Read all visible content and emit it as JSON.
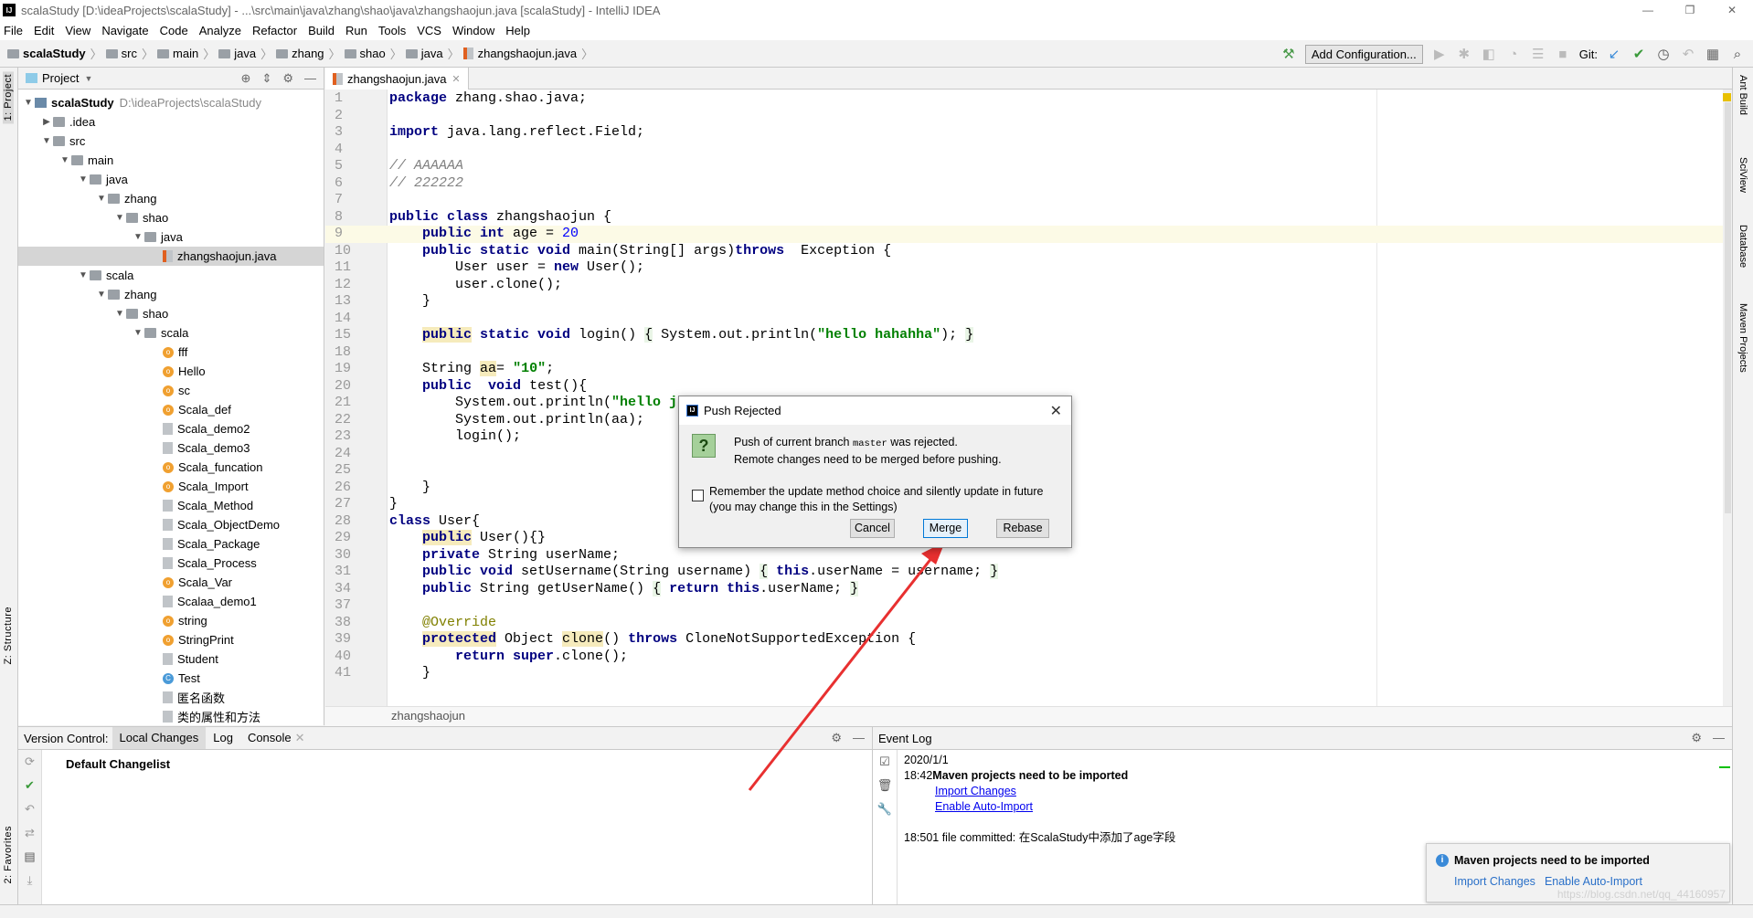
{
  "window": {
    "title": "scalaStudy [D:\\ideaProjects\\scalaStudy] - ...\\src\\main\\java\\zhang\\shao\\java\\zhangshaojun.java [scalaStudy] - IntelliJ IDEA",
    "logo": "IJ",
    "controls": [
      "—",
      "❐",
      "✕"
    ]
  },
  "menu": [
    "File",
    "Edit",
    "View",
    "Navigate",
    "Code",
    "Analyze",
    "Refactor",
    "Build",
    "Run",
    "Tools",
    "VCS",
    "Window",
    "Help"
  ],
  "breadcrumb": [
    "scalaStudy",
    "src",
    "main",
    "java",
    "zhang",
    "shao",
    "java",
    "zhangshaojun.java"
  ],
  "toolbar": {
    "add_configuration": "Add Configuration...",
    "git_label": "Git:"
  },
  "left_strip": {
    "project": "1: Project",
    "structure": "Z: Structure",
    "favorites": "2: Favorites"
  },
  "right_strip": [
    "Ant Build",
    "SciView",
    "Database",
    "Maven Projects"
  ],
  "project_panel": {
    "title": "Project",
    "tree": [
      {
        "label": "scalaStudy",
        "path": "D:\\ideaProjects\\scalaStudy",
        "level": 0,
        "icon": "mod",
        "open": true,
        "bold": true
      },
      {
        "label": ".idea",
        "level": 1,
        "icon": "folder",
        "open": false
      },
      {
        "label": "src",
        "level": 1,
        "icon": "folder",
        "open": true
      },
      {
        "label": "main",
        "level": 2,
        "icon": "folder",
        "open": true
      },
      {
        "label": "java",
        "level": 3,
        "icon": "folder",
        "open": true
      },
      {
        "label": "zhang",
        "level": 4,
        "icon": "folder",
        "open": true
      },
      {
        "label": "shao",
        "level": 5,
        "icon": "folder",
        "open": true
      },
      {
        "label": "java",
        "level": 6,
        "icon": "folder",
        "open": true
      },
      {
        "label": "zhangshaojun.java",
        "level": 7,
        "icon": "jav",
        "selected": true
      },
      {
        "label": "scala",
        "level": 3,
        "icon": "folder",
        "open": true
      },
      {
        "label": "zhang",
        "level": 4,
        "icon": "folder",
        "open": true
      },
      {
        "label": "shao",
        "level": 5,
        "icon": "folder",
        "open": true
      },
      {
        "label": "scala",
        "level": 6,
        "icon": "folder",
        "open": true
      },
      {
        "label": "fff",
        "level": 7,
        "icon": "obj"
      },
      {
        "label": "Hello",
        "level": 7,
        "icon": "obj"
      },
      {
        "label": "sc",
        "level": 7,
        "icon": "obj"
      },
      {
        "label": "Scala_def",
        "level": 7,
        "icon": "obj"
      },
      {
        "label": "Scala_demo2",
        "level": 7,
        "icon": "cls"
      },
      {
        "label": "Scala_demo3",
        "level": 7,
        "icon": "cls"
      },
      {
        "label": "Scala_funcation",
        "level": 7,
        "icon": "obj"
      },
      {
        "label": "Scala_Import",
        "level": 7,
        "icon": "obj"
      },
      {
        "label": "Scala_Method",
        "level": 7,
        "icon": "cls"
      },
      {
        "label": "Scala_ObjectDemo",
        "level": 7,
        "icon": "cls"
      },
      {
        "label": "Scala_Package",
        "level": 7,
        "icon": "cls"
      },
      {
        "label": "Scala_Process",
        "level": 7,
        "icon": "cls"
      },
      {
        "label": "Scala_Var",
        "level": 7,
        "icon": "obj"
      },
      {
        "label": "Scalaa_demo1",
        "level": 7,
        "icon": "cls"
      },
      {
        "label": "string",
        "level": 7,
        "icon": "obj"
      },
      {
        "label": "StringPrint",
        "level": 7,
        "icon": "obj"
      },
      {
        "label": "Student",
        "level": 7,
        "icon": "cls"
      },
      {
        "label": "Test",
        "level": 7,
        "icon": "tst"
      },
      {
        "label": "匿名函数",
        "level": 7,
        "icon": "cls"
      },
      {
        "label": "类的属性和方法",
        "level": 7,
        "icon": "cls"
      }
    ]
  },
  "editor": {
    "tab": "zhangshaojun.java",
    "breadcrumb": "zhangshaojun",
    "current_line": "9",
    "lines": [
      {
        "n": "1",
        "t": [
          [
            "package",
            "k"
          ],
          [
            " zhang.shao.java;"
          ]
        ]
      },
      {
        "n": "2",
        "t": []
      },
      {
        "n": "3",
        "t": [
          [
            "import",
            "k"
          ],
          [
            " java.lang.reflect.Field;"
          ]
        ]
      },
      {
        "n": "4",
        "t": []
      },
      {
        "n": "5",
        "t": [
          [
            "// AAAAAA",
            "c"
          ]
        ]
      },
      {
        "n": "6",
        "t": [
          [
            "// 222222",
            "c"
          ]
        ]
      },
      {
        "n": "7",
        "t": []
      },
      {
        "n": "8",
        "t": [
          [
            "public class",
            "k"
          ],
          [
            " zhangshaojun {"
          ]
        ]
      },
      {
        "n": "9",
        "t": [
          [
            "    "
          ],
          [
            "public int",
            "k"
          ],
          [
            " age = "
          ],
          [
            "20",
            "n"
          ]
        ]
      },
      {
        "n": "10",
        "t": [
          [
            "    "
          ],
          [
            "public static void",
            "k"
          ],
          [
            " main(String[] args)"
          ],
          [
            "throws",
            "k"
          ],
          [
            "  Exception {"
          ]
        ]
      },
      {
        "n": "11",
        "t": [
          [
            "        User user = "
          ],
          [
            "new",
            "k"
          ],
          [
            " User();"
          ]
        ]
      },
      {
        "n": "12",
        "t": [
          [
            "        user.clone();"
          ]
        ]
      },
      {
        "n": "13",
        "t": [
          [
            "    }"
          ]
        ]
      },
      {
        "n": "14",
        "t": []
      },
      {
        "n": "15",
        "t": [
          [
            "    "
          ],
          [
            "public",
            "k h"
          ],
          [
            " "
          ],
          [
            "static void",
            "k"
          ],
          [
            " login() "
          ],
          [
            "{",
            "f"
          ],
          [
            " System.out.println("
          ],
          [
            "\"hello hahahha\"",
            "s"
          ],
          [
            "); "
          ],
          [
            "}",
            "f"
          ]
        ]
      },
      {
        "n": "18",
        "t": []
      },
      {
        "n": "19",
        "t": [
          [
            "    String "
          ],
          [
            "aa",
            "h"
          ],
          [
            "= "
          ],
          [
            "\"10\"",
            "s"
          ],
          [
            ";"
          ]
        ]
      },
      {
        "n": "20",
        "t": [
          [
            "    "
          ],
          [
            "public",
            "k"
          ],
          [
            "  "
          ],
          [
            "void",
            "k"
          ],
          [
            " test(){"
          ]
        ]
      },
      {
        "n": "21",
        "t": [
          [
            "        System.out.println("
          ],
          [
            "\"hello j",
            "s"
          ]
        ]
      },
      {
        "n": "22",
        "t": [
          [
            "        System.out.println(aa);"
          ]
        ]
      },
      {
        "n": "23",
        "t": [
          [
            "        login();"
          ]
        ]
      },
      {
        "n": "24",
        "t": []
      },
      {
        "n": "25",
        "t": []
      },
      {
        "n": "26",
        "t": [
          [
            "    }"
          ]
        ]
      },
      {
        "n": "27",
        "t": [
          [
            "}"
          ]
        ]
      },
      {
        "n": "28",
        "t": [
          [
            "class",
            "k"
          ],
          [
            " User{"
          ]
        ]
      },
      {
        "n": "29",
        "t": [
          [
            "    "
          ],
          [
            "public",
            "k h"
          ],
          [
            " User(){}"
          ]
        ]
      },
      {
        "n": "30",
        "t": [
          [
            "    "
          ],
          [
            "private",
            "k"
          ],
          [
            " String userName;"
          ]
        ]
      },
      {
        "n": "31",
        "t": [
          [
            "    "
          ],
          [
            "public void",
            "k"
          ],
          [
            " setUsername(String username) "
          ],
          [
            "{",
            "f"
          ],
          [
            " "
          ],
          [
            "this",
            "k"
          ],
          [
            ".userName = username; "
          ],
          [
            "}",
            "f"
          ]
        ]
      },
      {
        "n": "34",
        "t": [
          [
            "    "
          ],
          [
            "public",
            "k"
          ],
          [
            " String getUserName() "
          ],
          [
            "{",
            "f"
          ],
          [
            " "
          ],
          [
            "return this",
            "k"
          ],
          [
            ".userName; "
          ],
          [
            "}",
            "f"
          ]
        ]
      },
      {
        "n": "37",
        "t": []
      },
      {
        "n": "38",
        "t": [
          [
            "    "
          ],
          [
            "@Override",
            "a"
          ]
        ]
      },
      {
        "n": "39",
        "t": [
          [
            "    "
          ],
          [
            "protected",
            "k h"
          ],
          [
            " Object "
          ],
          [
            "clone",
            "h"
          ],
          [
            "() "
          ],
          [
            "throws",
            "k"
          ],
          [
            " CloneNotSupportedException {"
          ]
        ]
      },
      {
        "n": "40",
        "t": [
          [
            "        "
          ],
          [
            "return super",
            "k"
          ],
          [
            ".clone();"
          ]
        ]
      },
      {
        "n": "41",
        "t": [
          [
            "    }"
          ]
        ]
      }
    ]
  },
  "version_control": {
    "label": "Version Control:",
    "tabs": [
      "Local Changes",
      "Log",
      "Console"
    ],
    "active_tab": "Local Changes",
    "changelist": "Default Changelist"
  },
  "event_log": {
    "title": "Event Log",
    "date": "2020/1/1",
    "entries": [
      {
        "time": "18:42",
        "message": "Maven projects need to be imported",
        "links": [
          "Import Changes",
          "Enable Auto-Import"
        ]
      },
      {
        "time": "18:50",
        "message": "1 file committed: 在ScalaStudy中添加了age字段"
      }
    ]
  },
  "notification": {
    "title": "Maven projects need to be imported",
    "links": [
      "Import Changes",
      "Enable Auto-Import"
    ]
  },
  "dialog": {
    "title": "Push Rejected",
    "message_prefix": "Push of current branch ",
    "branch": "master",
    "message_suffix": " was rejected.",
    "message_line2": "Remote changes need to be merged before pushing.",
    "checkbox_line1": "Remember the update method choice and silently update in future",
    "checkbox_line2": "(you may change this in the Settings)",
    "checked": false,
    "buttons": [
      "Cancel",
      "Merge",
      "Rebase"
    ],
    "default_button": "Merge"
  },
  "watermark": "https://blog.csdn.net/qq_44160957",
  "colors": {
    "keyword": "#000080",
    "string": "#008000",
    "number": "#0000ff",
    "annotation_arrow": "#e83030",
    "link": "#0000ee"
  }
}
